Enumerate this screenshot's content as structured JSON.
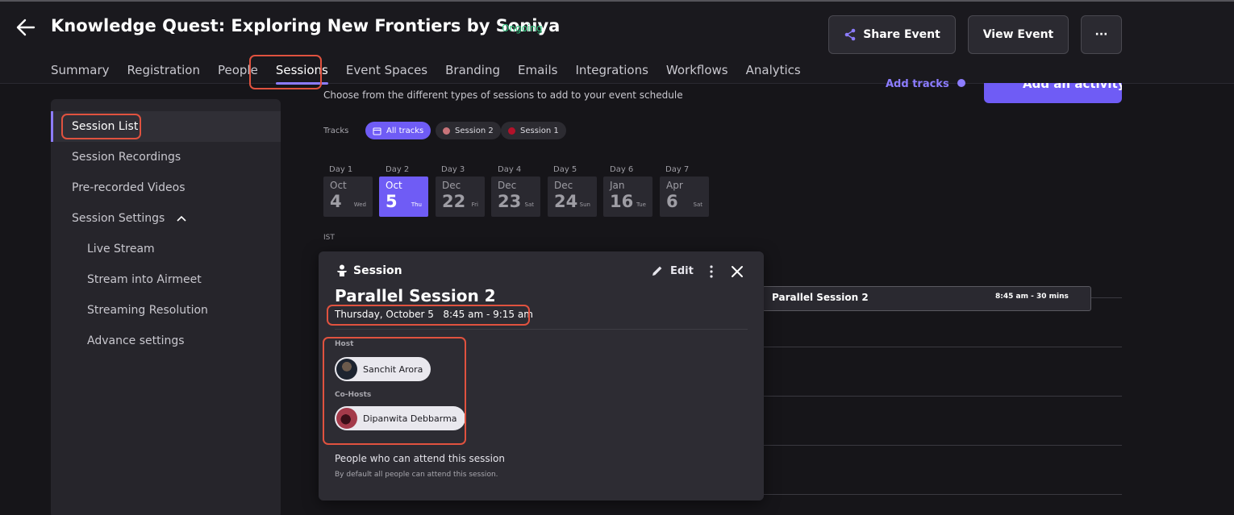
{
  "header": {
    "title": "Knowledge Quest: Exploring New Frontiers by Soniya",
    "status": "Ongoing",
    "share_label": "Share Event",
    "view_label": "View Event",
    "more_label": "···"
  },
  "tabs": [
    {
      "label": "Summary"
    },
    {
      "label": "Registration"
    },
    {
      "label": "People"
    },
    {
      "label": "Sessions"
    },
    {
      "label": "Event Spaces"
    },
    {
      "label": "Branding"
    },
    {
      "label": "Emails"
    },
    {
      "label": "Integrations"
    },
    {
      "label": "Workflows"
    },
    {
      "label": "Analytics"
    }
  ],
  "active_tab": "Sessions",
  "sidebar": {
    "items": [
      {
        "label": "Session List"
      },
      {
        "label": "Session Recordings"
      },
      {
        "label": "Pre-recorded Videos"
      },
      {
        "label": "Session Settings"
      },
      {
        "label": "Live Stream"
      },
      {
        "label": "Stream into Airmeet"
      },
      {
        "label": "Streaming Resolution"
      },
      {
        "label": "Advance settings"
      }
    ]
  },
  "main": {
    "subtitle": "Choose from the different types of sessions to add to your event schedule",
    "add_tracks": "Add tracks",
    "add_activity": "Add an activity",
    "tracks_label": "Tracks",
    "tracks": [
      {
        "label": "All tracks",
        "color": "#6f5cf5"
      },
      {
        "label": "Session 2",
        "color": "#c9747a"
      },
      {
        "label": "Session 1",
        "color": "#b3122a"
      }
    ],
    "days": [
      {
        "label": "Day 1",
        "month": "Oct",
        "date": "4",
        "weekday": "Wed"
      },
      {
        "label": "Day 2",
        "month": "Oct",
        "date": "5",
        "weekday": "Thu"
      },
      {
        "label": "Day 3",
        "month": "Dec",
        "date": "22",
        "weekday": "Fri"
      },
      {
        "label": "Day 4",
        "month": "Dec",
        "date": "23",
        "weekday": "Sat"
      },
      {
        "label": "Day 5",
        "month": "Dec",
        "date": "24",
        "weekday": "Sun"
      },
      {
        "label": "Day 6",
        "month": "Jan",
        "date": "16",
        "weekday": "Tue"
      },
      {
        "label": "Day 7",
        "month": "Apr",
        "date": "6",
        "weekday": "Sat"
      }
    ],
    "timezone": "IST",
    "event_block": {
      "title": "Parallel Session 2",
      "meta": "8:45 am - 30 mins"
    }
  },
  "popover": {
    "kind": "Session",
    "edit_label": "Edit",
    "title": "Parallel Session 2",
    "time": "Thursday, October 5   8:45 am - 9:15 am",
    "host_label": "Host",
    "host_name": "Sanchit Arora",
    "cohost_label": "Co-Hosts",
    "cohost_name": "Dipanwita Debbarma",
    "attend_title": "People who can attend this session",
    "attend_note": "By default all people can attend this session."
  },
  "colors": {
    "accent": "#6f5cf5",
    "highlight": "#e0523f",
    "status_green": "#2fc77f"
  }
}
